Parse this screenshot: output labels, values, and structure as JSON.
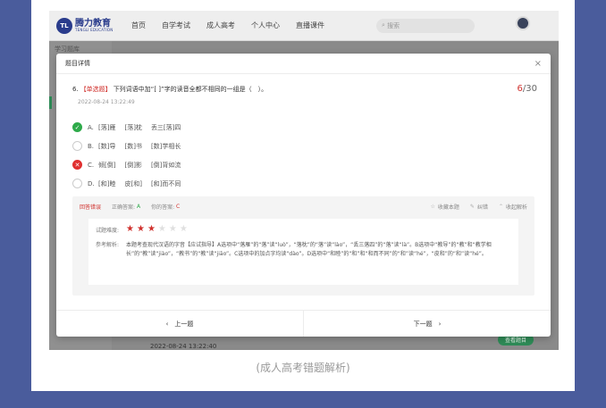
{
  "brand": {
    "name": "腾力教育",
    "sub": "TENGLI EDUCATION",
    "mark": "TL"
  },
  "nav": {
    "items": [
      "首页",
      "自学考试",
      "成人高考",
      "个人中心",
      "直播课件"
    ],
    "search_placeholder": "搜索"
  },
  "background": {
    "sidebar_title": "学习题库",
    "date": "2022-08-24 13:22:40",
    "button": "查看题目"
  },
  "modal": {
    "title": "题目详情",
    "close": "×",
    "question": {
      "number": "6.",
      "type": "【单选题】",
      "text": "下列词语中加“[ ]”字的读音全都不相同的一组是（　）。",
      "current": "6",
      "total": "/30",
      "date": "2022-08-24 13:22:49"
    },
    "options": [
      {
        "label": "A.",
        "parts": [
          "[落]雁",
          "[落]枕",
          "丢三[落]四"
        ],
        "status": "correct"
      },
      {
        "label": "B.",
        "parts": [
          "[数]导",
          "[数]书",
          "[数]学相长"
        ],
        "status": "none"
      },
      {
        "label": "C.",
        "parts": [
          "倾[倒]",
          "[倒]影",
          "[倒]背如流"
        ],
        "status": "wrong"
      },
      {
        "label": "D.",
        "parts": [
          "[和]睦",
          "皮[和]",
          "[和]而不同"
        ],
        "status": "none"
      }
    ],
    "analysis": {
      "result": "回答错误",
      "correct_label": "正确答案:",
      "correct_value": "A",
      "your_label": "你的答案:",
      "your_value": "C",
      "actions": [
        "收藏本题",
        "纠错",
        "收起解析"
      ],
      "difficulty_label": "试题难度:",
      "stars_on": 3,
      "stars_total": 6,
      "explain_label": "参考解析:",
      "explain_text": "本题考查现代汉语的字音【应试指导】A选项中“落雁”的“落”读“luò”，“落枕”的“落”读“lào”，“丢三落四”的“落”读“là”。B选项中“教导”的“教”和“教学相长”的“教”读“jiào”，“教书”的“教”读“jiāo”。C选项中的加点字均读“dào”。D选项中“和睦”的“和”和“和而不同”的“和”读“hé”，“皮和”的“和”读“hé”。"
    },
    "footer": {
      "prev": "‹　上一题",
      "next": "下一题　›"
    }
  },
  "caption": "(成人高考错题解析)",
  "colors": {
    "accent_red": "#d0312d",
    "correct_green": "#2eaa4a",
    "outer_bg": "#4a5c9c"
  }
}
